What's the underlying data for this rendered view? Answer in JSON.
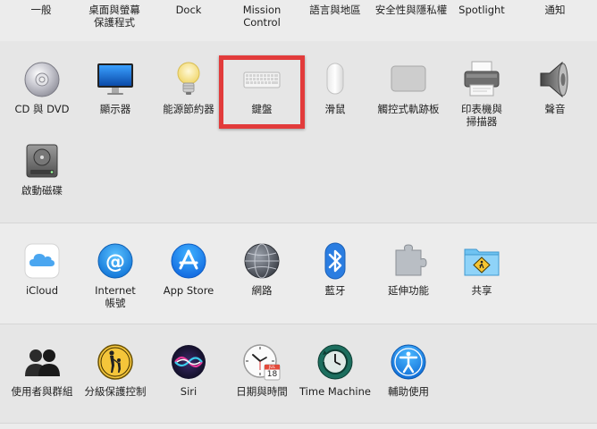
{
  "top_row": [
    "一般",
    "桌面與螢幕\n保護程式",
    "Dock",
    "Mission\nControl",
    "語言與地區",
    "安全性與隱私權",
    "Spotlight",
    "通知"
  ],
  "hardware_row": [
    {
      "label": "CD 與 DVD",
      "icon": "cd-dvd-icon"
    },
    {
      "label": "顯示器",
      "icon": "display-icon"
    },
    {
      "label": "能源節約器",
      "icon": "lightbulb-icon"
    },
    {
      "label": "鍵盤",
      "icon": "keyboard-icon"
    },
    {
      "label": "滑鼠",
      "icon": "mouse-icon"
    },
    {
      "label": "觸控式軌跡板",
      "icon": "trackpad-icon"
    },
    {
      "label": "印表機與\n掃描器",
      "icon": "printer-icon"
    },
    {
      "label": "聲音",
      "icon": "speaker-icon"
    },
    {
      "label": "啟動磁碟",
      "icon": "startup-disk-icon"
    }
  ],
  "internet_row": [
    {
      "label": "iCloud",
      "icon": "icloud-icon"
    },
    {
      "label": "Internet\n帳號",
      "icon": "internet-accounts-icon"
    },
    {
      "label": "App Store",
      "icon": "app-store-icon"
    },
    {
      "label": "網路",
      "icon": "network-globe-icon"
    },
    {
      "label": "藍牙",
      "icon": "bluetooth-icon"
    },
    {
      "label": "延伸功能",
      "icon": "extensions-puzzle-icon"
    },
    {
      "label": "共享",
      "icon": "sharing-folder-icon"
    }
  ],
  "system_row": [
    {
      "label": "使用者與群組",
      "icon": "users-groups-icon"
    },
    {
      "label": "分級保護控制",
      "icon": "parental-controls-icon"
    },
    {
      "label": "Siri",
      "icon": "siri-icon"
    },
    {
      "label": "日期與時間",
      "icon": "clock-calendar-icon"
    },
    {
      "label": "Time Machine",
      "icon": "time-machine-icon"
    },
    {
      "label": "輔助使用",
      "icon": "accessibility-icon"
    }
  ],
  "calendar_badge": {
    "month": "JUL",
    "day": "18"
  },
  "colors": {
    "highlight": "#e23b3b",
    "app_store_blue": "#1a8cf5",
    "bluetooth_blue": "#2a7de1"
  }
}
